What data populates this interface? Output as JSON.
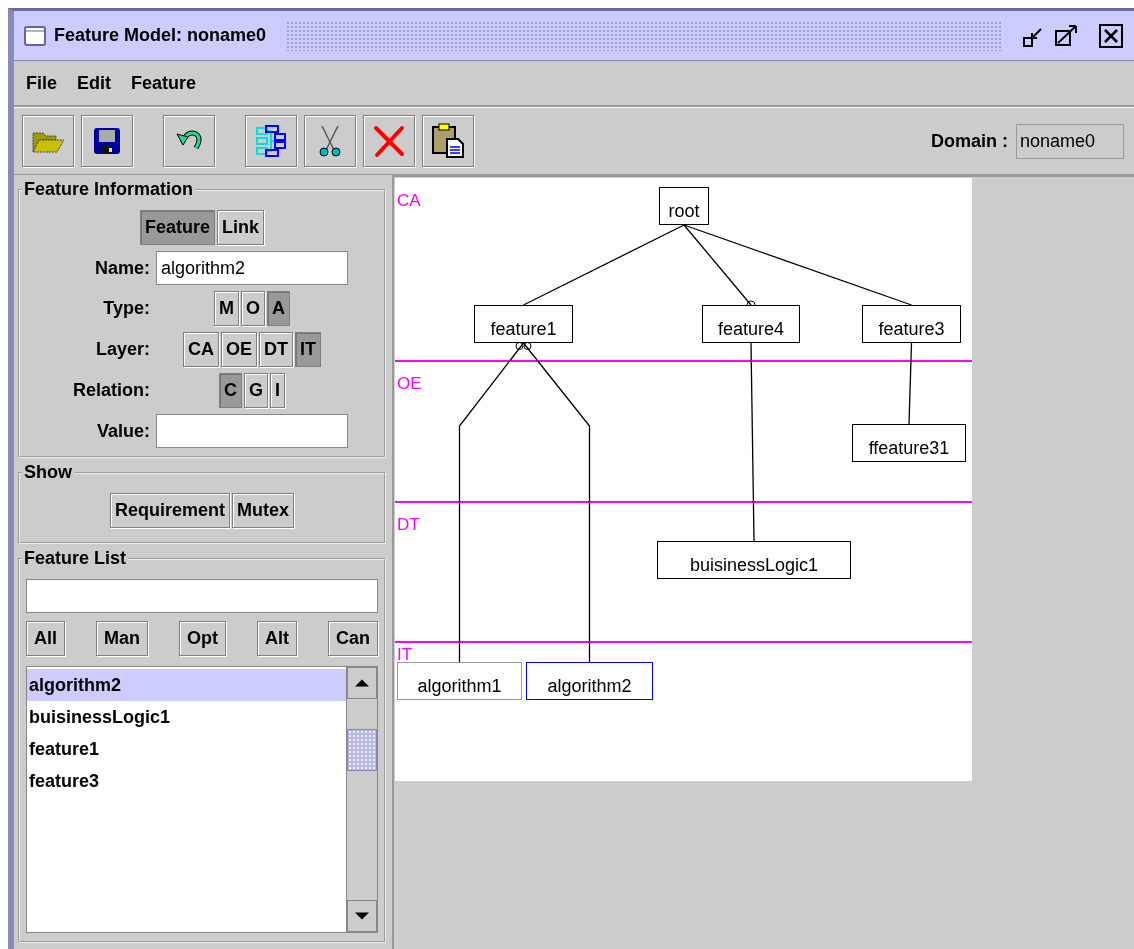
{
  "window": {
    "title": "Feature Model: noname0"
  },
  "menu": [
    {
      "label": "File"
    },
    {
      "label": "Edit"
    },
    {
      "label": "Feature"
    }
  ],
  "toolbar": {
    "groups": [
      [
        {
          "kind": "open"
        },
        {
          "kind": "save"
        }
      ],
      [
        {
          "kind": "undo"
        }
      ],
      [
        {
          "kind": "layout"
        },
        {
          "kind": "cut"
        },
        {
          "kind": "delete"
        },
        {
          "kind": "paste"
        }
      ]
    ],
    "domain_label": "Domain :",
    "domain_value": "noname0"
  },
  "feature_information": {
    "title": "Feature Information",
    "modes": [
      {
        "label": "Feature",
        "selected": true
      },
      {
        "label": "Link",
        "selected": false
      }
    ],
    "name_label": "Name:",
    "name_value": "algorithm2",
    "rows": [
      {
        "label": "Type:",
        "options": [
          {
            "label": "M",
            "selected": false
          },
          {
            "label": "O",
            "selected": false
          },
          {
            "label": "A",
            "selected": true
          }
        ]
      },
      {
        "label": "Layer:",
        "options": [
          {
            "label": "CA",
            "selected": false
          },
          {
            "label": "OE",
            "selected": false
          },
          {
            "label": "DT",
            "selected": false
          },
          {
            "label": "IT",
            "selected": true
          }
        ]
      },
      {
        "label": "Relation:",
        "options": [
          {
            "label": "C",
            "selected": true
          },
          {
            "label": "G",
            "selected": false
          },
          {
            "label": "I",
            "selected": false
          }
        ]
      }
    ],
    "value_label": "Value:"
  },
  "show": {
    "title": "Show",
    "buttons": [
      {
        "label": "Requirement"
      },
      {
        "label": "Mutex"
      }
    ]
  },
  "feature_list": {
    "title": "Feature List",
    "filters": [
      {
        "label": "All"
      },
      {
        "label": "Man"
      },
      {
        "label": "Opt"
      },
      {
        "label": "Alt"
      },
      {
        "label": "Can"
      }
    ],
    "items": [
      {
        "label": "algorithm2",
        "selected": true
      },
      {
        "label": "buisinessLogic1",
        "selected": false
      },
      {
        "label": "feature1",
        "selected": false
      },
      {
        "label": "feature3",
        "selected": false
      }
    ]
  },
  "diagram": {
    "layers": [
      {
        "label": "CA"
      },
      {
        "label": "OE"
      },
      {
        "label": "DT"
      },
      {
        "label": "IT"
      }
    ],
    "root": {
      "label": "root",
      "selected": false,
      "dimmed": false,
      "children": [
        {
          "label": "feature1",
          "selected": false,
          "dimmed": false,
          "kind": "mandatory",
          "children": [
            {
              "label": "algorithm1",
              "selected": false,
              "dimmed": true,
              "kind": "alternative"
            },
            {
              "label": "algorithm2",
              "selected": true,
              "dimmed": false,
              "kind": "alternative"
            }
          ]
        },
        {
          "label": "feature4",
          "selected": false,
          "dimmed": false,
          "kind": "optional",
          "children": [
            {
              "label": "buisinessLogic1",
              "selected": false,
              "dimmed": false,
              "kind": "mandatory"
            }
          ]
        },
        {
          "label": "feature3",
          "selected": false,
          "dimmed": false,
          "kind": "mandatory",
          "children": [
            {
              "label": "ffeature31",
              "selected": false,
              "dimmed": false,
              "kind": "mandatory"
            }
          ]
        }
      ]
    }
  }
}
